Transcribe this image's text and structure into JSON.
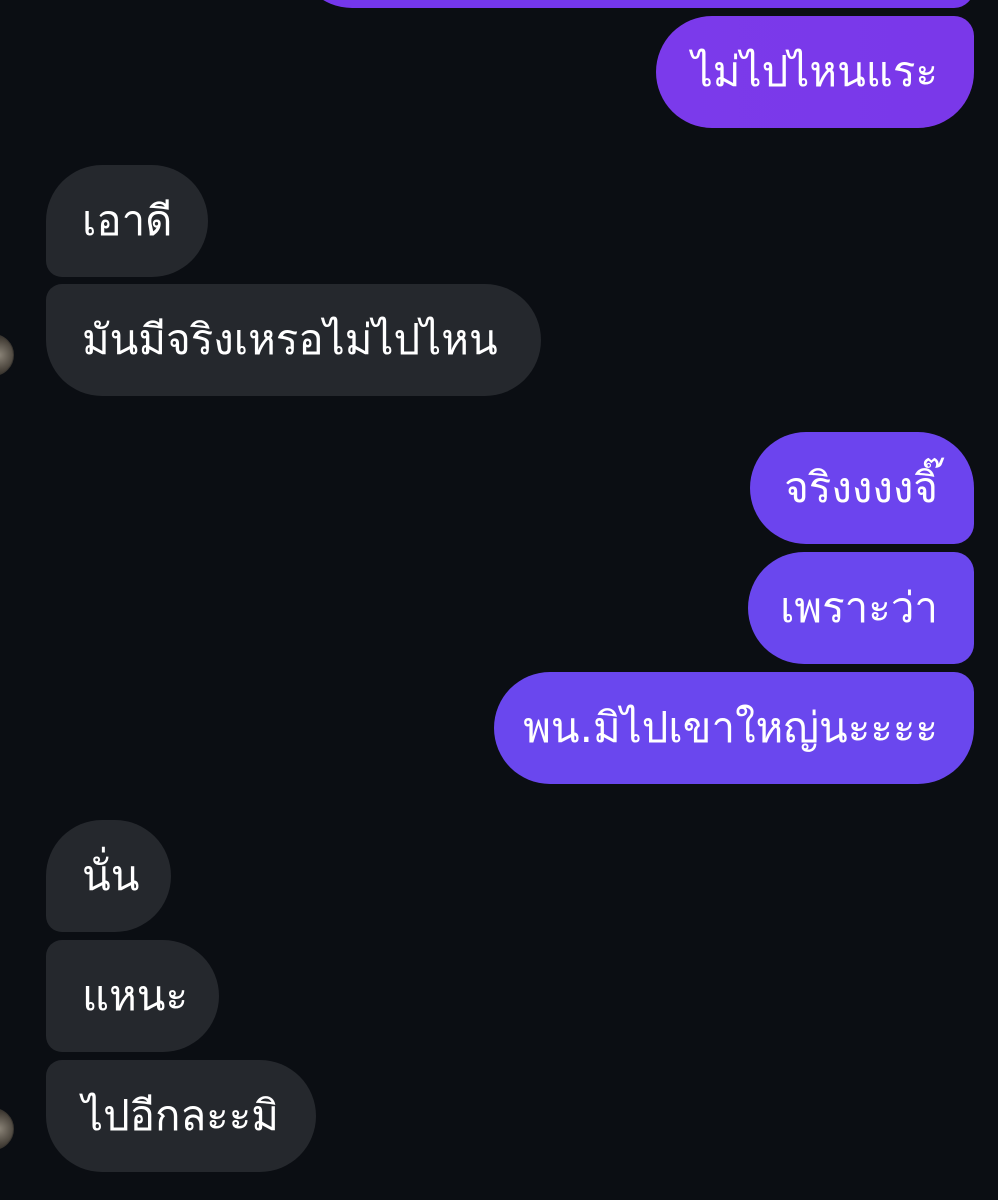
{
  "colors": {
    "background": "#0b0e13",
    "incoming_bubble": "#25282d",
    "outgoing_bubble_start": "#7c3ced",
    "outgoing_bubble_end": "#6a47ee",
    "text": "#ffffff"
  },
  "messages": [
    {
      "direction": "outgoing",
      "text": "ไม่ไปไหนแระ"
    },
    {
      "direction": "incoming",
      "text": "เอาดี"
    },
    {
      "direction": "incoming",
      "text": "มันมีจริงเหรอไม่ไปไหน"
    },
    {
      "direction": "outgoing",
      "text": "จริงงงงจิ๊"
    },
    {
      "direction": "outgoing",
      "text": "เพราะว่า"
    },
    {
      "direction": "outgoing",
      "text": "พน.มิไปเขาใหญ่นะะะะ"
    },
    {
      "direction": "incoming",
      "text": "นั่น"
    },
    {
      "direction": "incoming",
      "text": "แหนะ"
    },
    {
      "direction": "incoming",
      "text": "ไปอีกละะมิ"
    }
  ]
}
